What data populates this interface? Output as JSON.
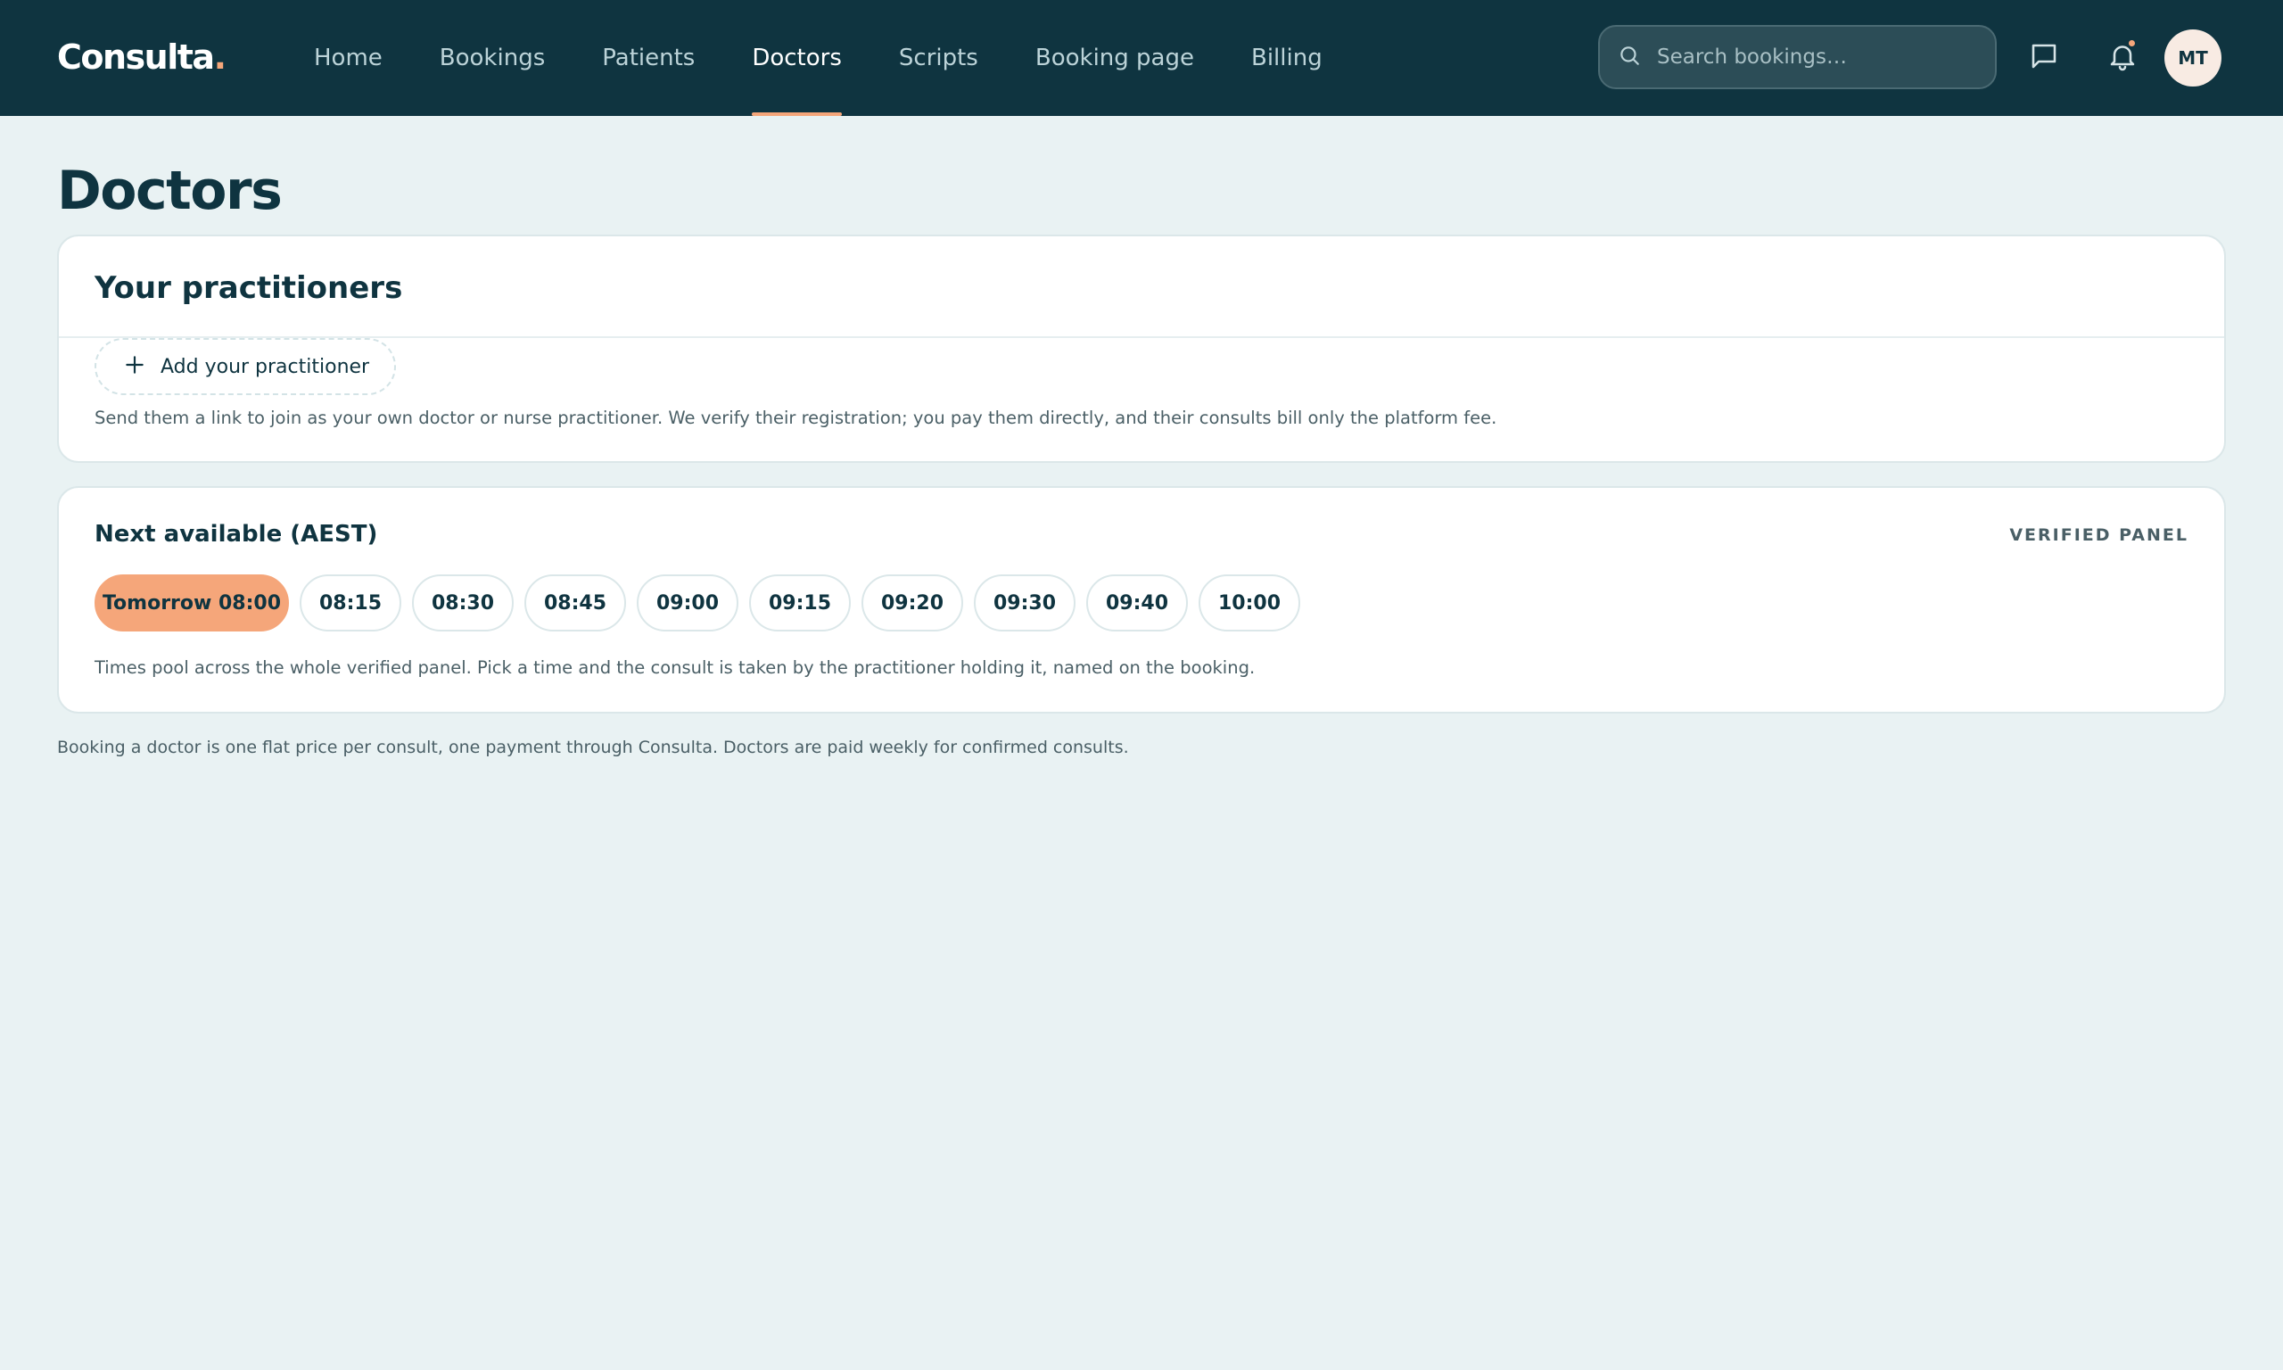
{
  "app": {
    "logo_text": "Consulta",
    "logo_dot": ".",
    "accent_color": "#f5a67a",
    "nav_bg_color": "#0f3440"
  },
  "nav": {
    "items": [
      {
        "label": "Home"
      },
      {
        "label": "Bookings"
      },
      {
        "label": "Patients"
      },
      {
        "label": "Doctors",
        "active": true
      },
      {
        "label": "Scripts"
      },
      {
        "label": "Booking page"
      },
      {
        "label": "Billing"
      }
    ]
  },
  "header": {
    "search_placeholder": "Search bookings…",
    "search_value": "",
    "icons": [
      "search-icon",
      "chat-icon",
      "bell-icon"
    ],
    "notification_dot": true,
    "avatar_initials": "MT"
  },
  "page": {
    "title": "Doctors"
  },
  "practitioners": {
    "title": "Your practitioners",
    "add_button_label": "Add your practitioner",
    "add_icon": "plus-icon",
    "note": "Send them a link to join as your own doctor or nurse practitioner. We verify their registration; you pay them directly, and their consults bill only the platform fee."
  },
  "availability": {
    "title": "Next available (AEST)",
    "panel_label": "VERIFIED PANEL",
    "slots": [
      {
        "label": "Tomorrow 08:00",
        "selected": true
      },
      {
        "label": "08:15"
      },
      {
        "label": "08:30"
      },
      {
        "label": "08:45"
      },
      {
        "label": "09:00"
      },
      {
        "label": "09:15"
      },
      {
        "label": "09:20"
      },
      {
        "label": "09:30"
      },
      {
        "label": "09:40"
      },
      {
        "label": "10:00"
      }
    ],
    "note": "Times pool across the whole verified panel. Pick a time and the consult is taken by the practitioner holding it, named on the booking."
  },
  "footer": {
    "note": "Booking a doctor is one flat price per consult, one payment through Consulta. Doctors are paid weekly for confirmed consults."
  }
}
